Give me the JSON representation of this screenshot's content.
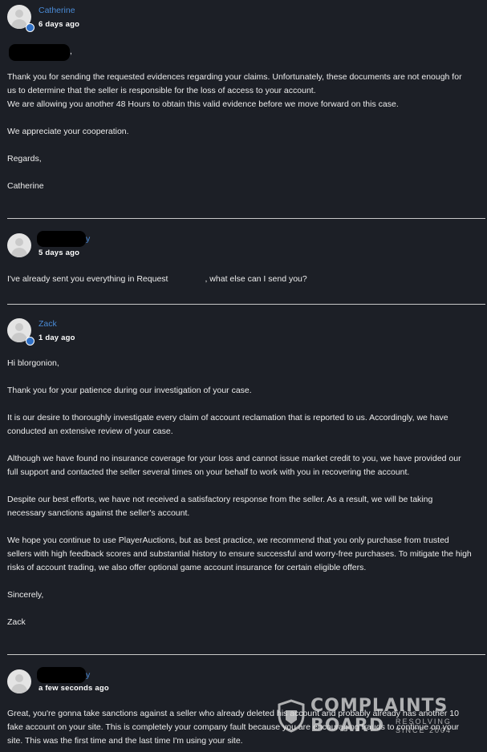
{
  "messages": [
    {
      "author": "Catherine",
      "time": "6 days ago",
      "greeting_suffix": ",",
      "paragraphs": [
        "Thank you for sending the requested evidences regarding your claims. Unfortunately, these documents are not enough for us to determine that the seller is responsible for the loss of access to your account.",
        "We are allowing you another 48 Hours to obtain this valid evidence before we move forward on this case.",
        "We appreciate your cooperation.",
        "Regards,",
        "Catherine"
      ]
    },
    {
      "author_tail": "y",
      "time": "5 days ago",
      "text_before": "I've already sent you everything in Request",
      "text_after": ", what else can I send you?"
    },
    {
      "author": "Zack",
      "time": "1 day ago",
      "paragraphs": [
        "Hi blorgonion,",
        "Thank you for your patience during our investigation of your case.",
        "It is our desire to thoroughly investigate every claim of account reclamation that is reported to us. Accordingly, we have conducted an extensive review of your case.",
        "Although we have found no insurance coverage for your loss and cannot issue market credit to you, we have provided our full support and contacted the seller several times on your behalf to work with you in recovering the account.",
        "Despite our best efforts, we have not received a satisfactory response from the seller. As a result, we will be taking necessary sanctions against the seller's account.",
        "We hope you continue to use PlayerAuctions, but as best practice, we recommend that you only purchase from trusted sellers with high feedback scores and substantial history to ensure successful and worry-free purchases. To mitigate the high risks of account trading, we also offer optional game account insurance for certain eligible offers.",
        "Sincerely,",
        "Zack"
      ]
    },
    {
      "author_tail": "y",
      "time": "a few seconds ago",
      "paragraphs": [
        "Great, you're gonna take sanctions against a seller who already deleted his account and probably already has another 10 fake account on your site. This is completely your company fault because you are encouraging frauds to continue on your site. This was the first time and the last time I'm using your site."
      ]
    }
  ],
  "watermark": {
    "line1": "COMPLAINTS",
    "line2": "BOARD",
    "tag1": "RESOLVING",
    "tag2": "SINCE 2004"
  },
  "colors": {
    "background": "#1c1f26",
    "author_link": "#4a8bd6",
    "staff_badge": "#2f6fc4"
  }
}
